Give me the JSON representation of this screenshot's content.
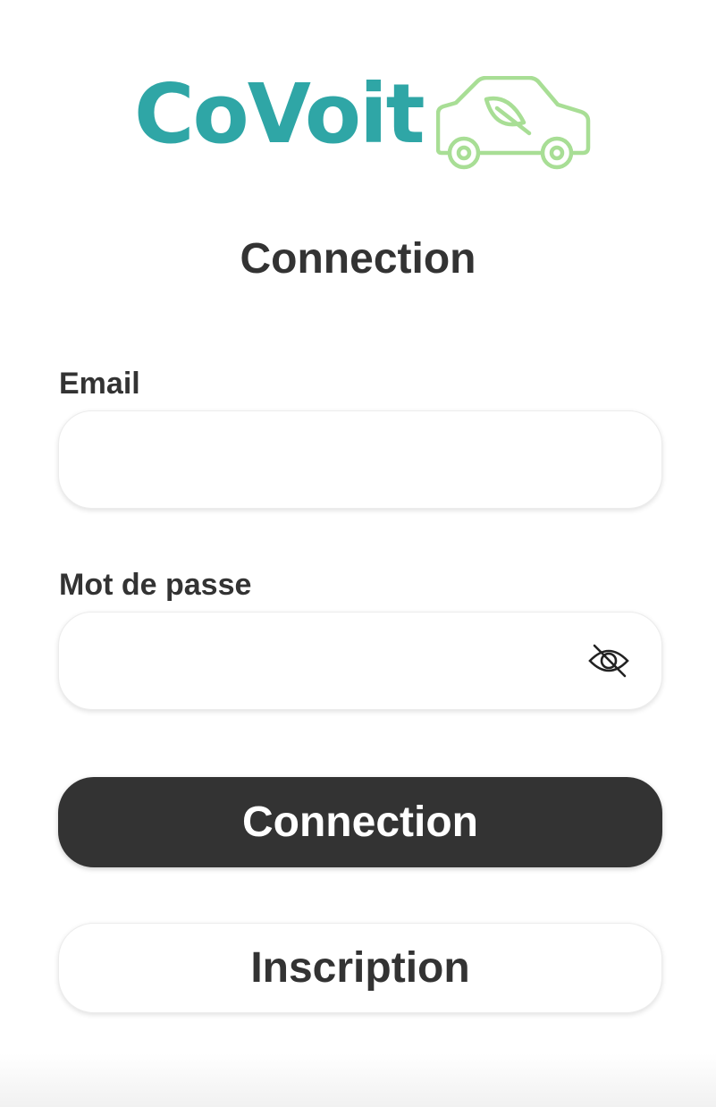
{
  "app": {
    "logo_text": "CoVoit",
    "logo_icon": "car-with-leaf-icon",
    "brand_color": "#2fa6a6",
    "accent_color": "#9fdc8c"
  },
  "page": {
    "title": "Connection"
  },
  "form": {
    "email_label": "Email",
    "email_value": "",
    "email_placeholder": "",
    "password_label": "Mot de passe",
    "password_value": "",
    "password_placeholder": "",
    "password_toggle_icon": "eye-slash-icon"
  },
  "actions": {
    "login_label": "Connection",
    "register_label": "Inscription",
    "primary_color": "#333333"
  }
}
